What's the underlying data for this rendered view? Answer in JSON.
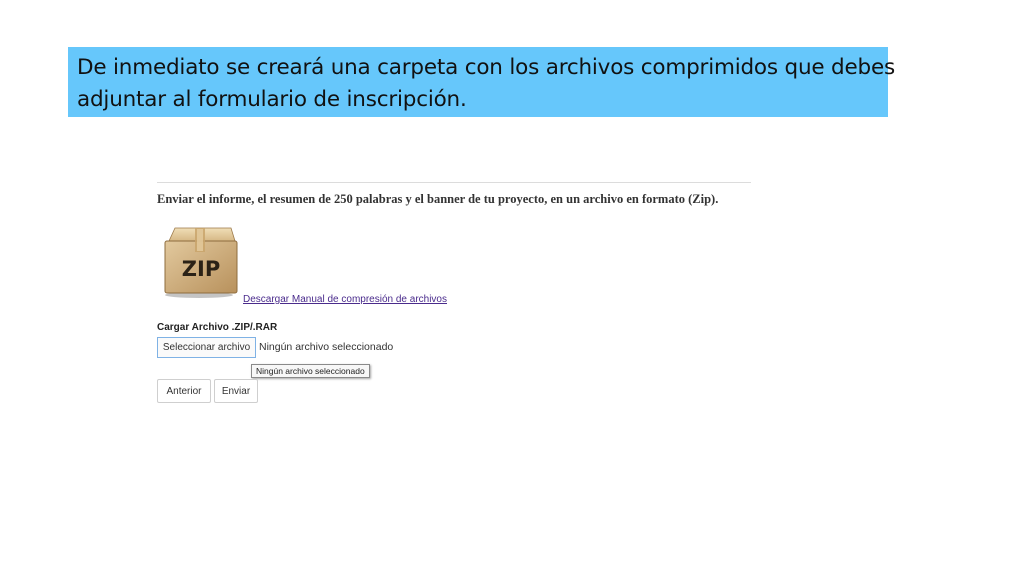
{
  "callout": {
    "line1": "De inmediato se creará una carpeta con los archivos comprimidos que debes",
    "line2": "adjuntar al formulario de inscripción.",
    "background": "#66c7fb"
  },
  "form": {
    "instruction": "Enviar el informe, el resumen de 250 palabras y el banner de tu proyecto, en un archivo en formato (Zip).",
    "zip_icon": {
      "name": "zip-archive-icon",
      "label": "ZIP"
    },
    "manual_link": "Descargar Manual de compresión de archivos",
    "upload_label": "Cargar Archivo .ZIP/.RAR",
    "file_button": "Seleccionar archivo",
    "file_status": "Ningún archivo seleccionado",
    "tooltip": "Ningún archivo seleccionado",
    "prev_button": "Anterior",
    "send_button": "Enviar"
  }
}
